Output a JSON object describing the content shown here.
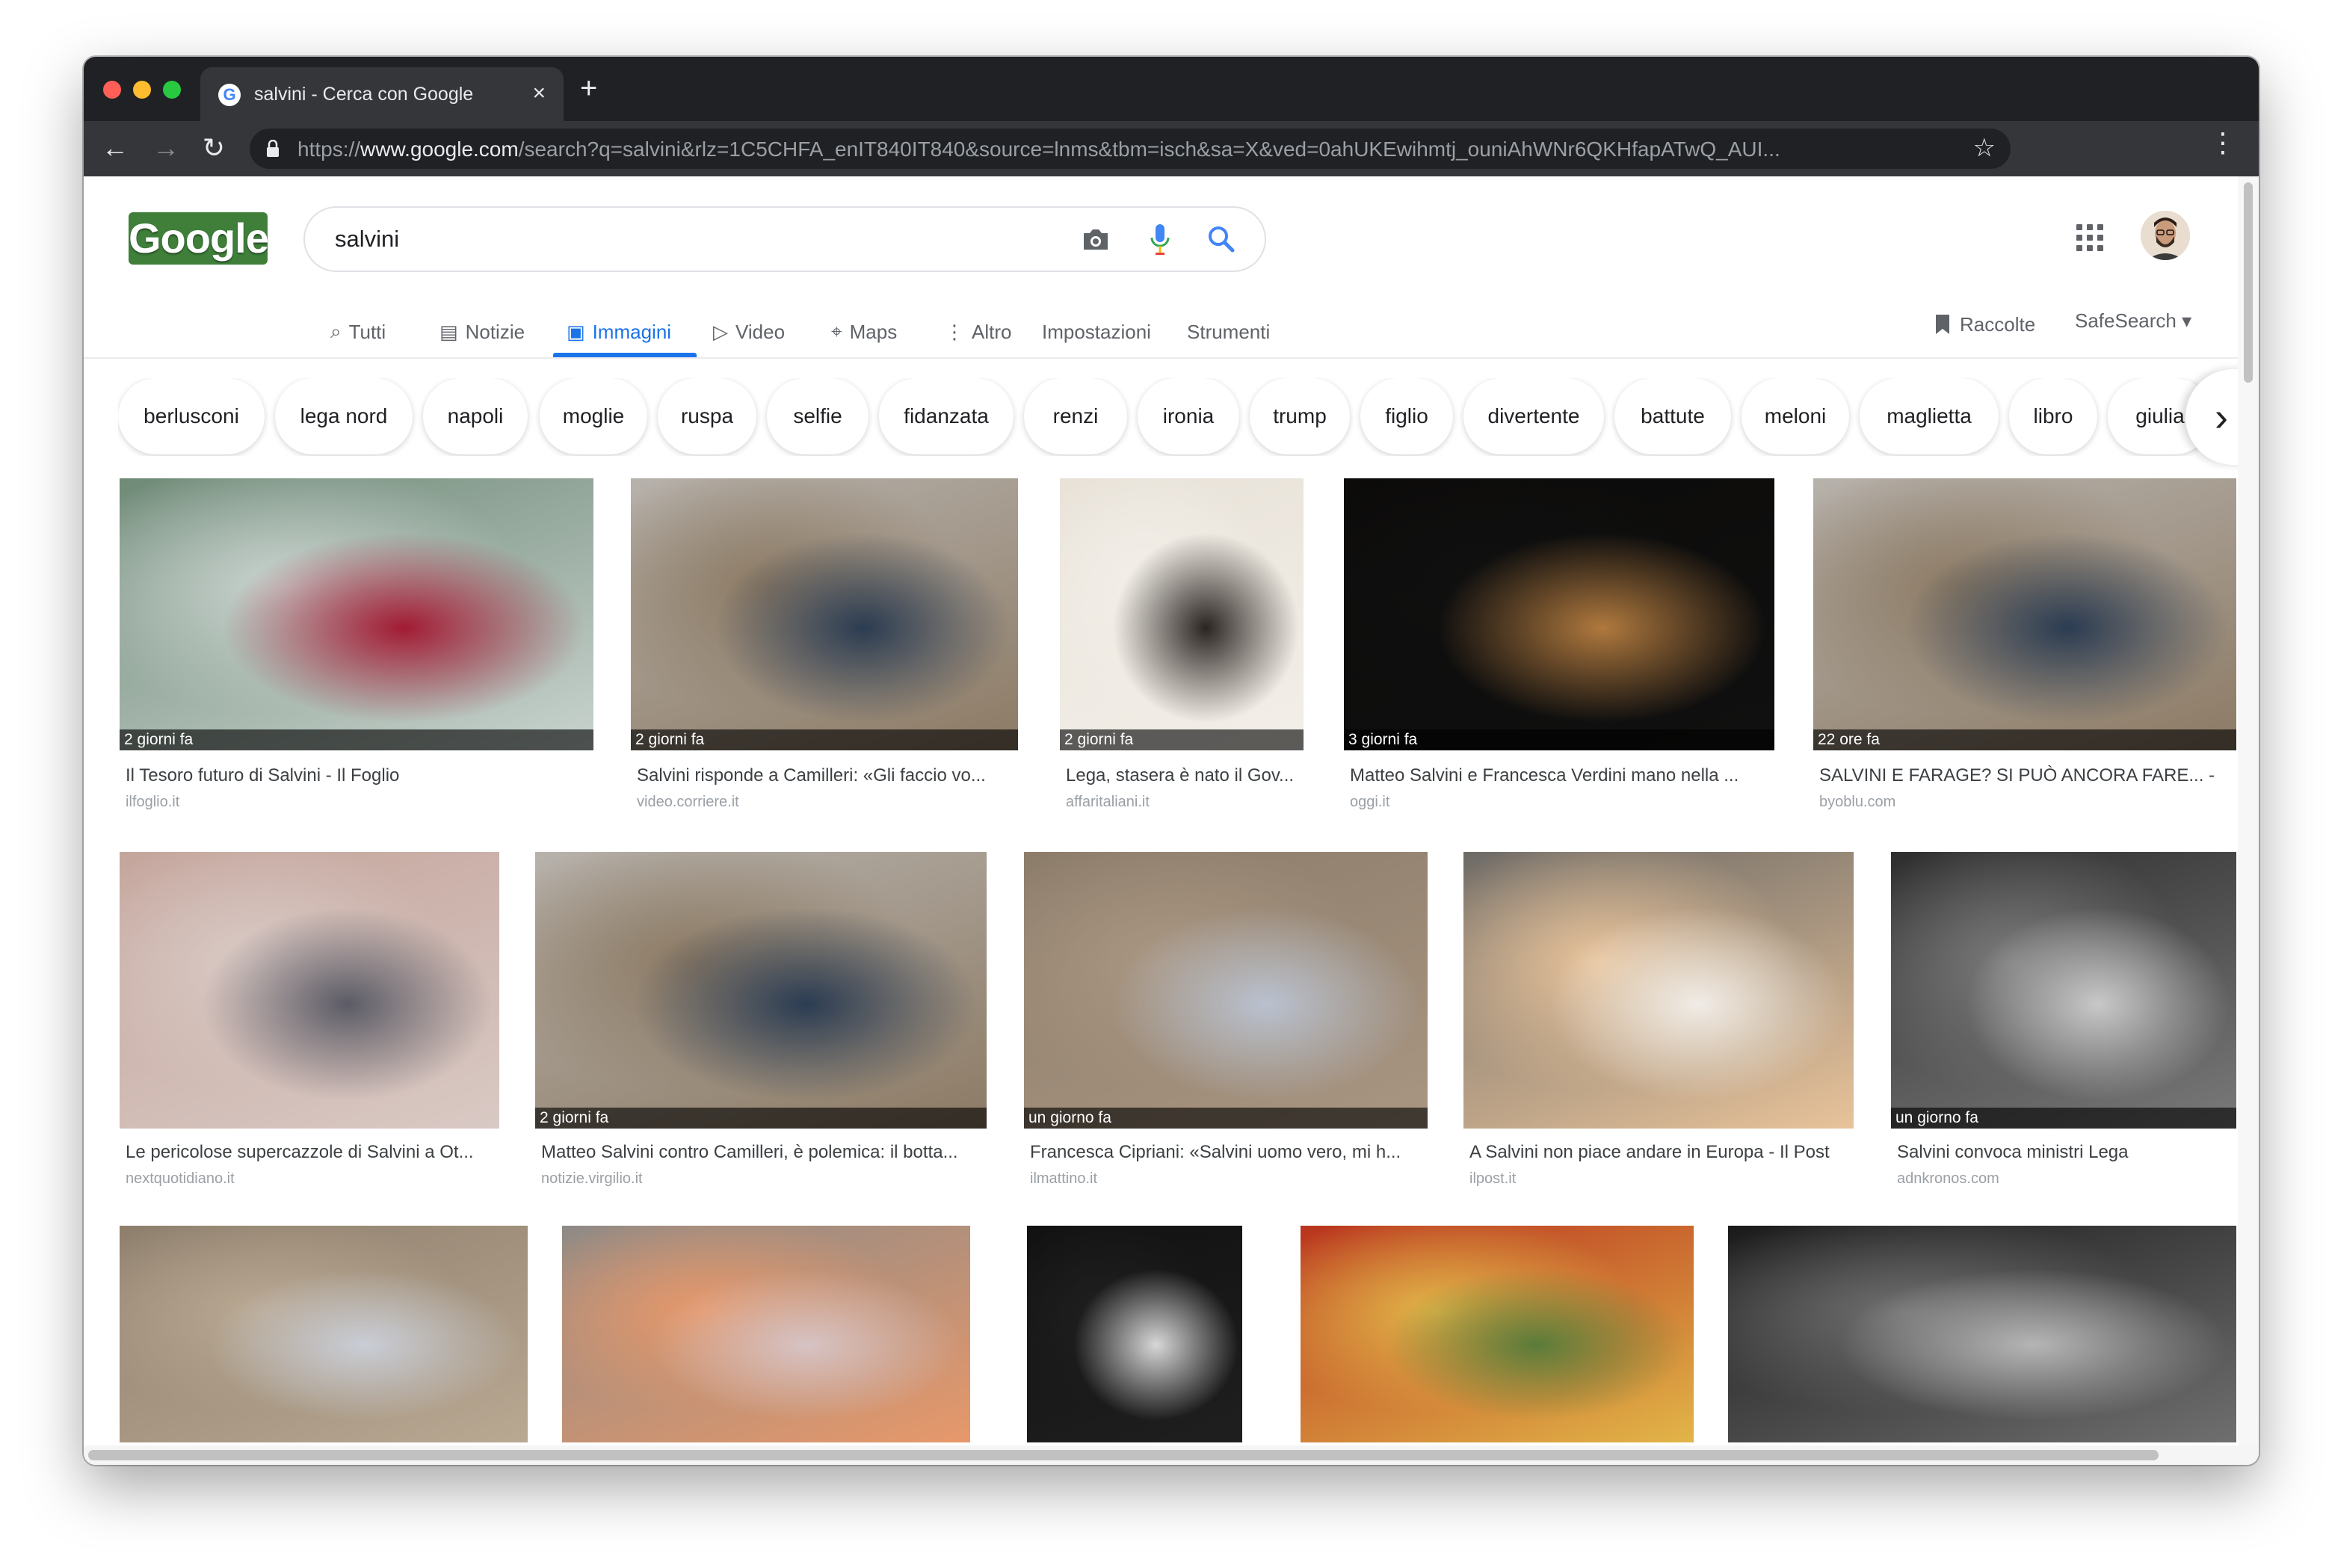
{
  "browser": {
    "tab_title": "salvini - Cerca con Google",
    "tab_close": "×",
    "new_tab": "+",
    "url_scheme": "https://",
    "url_host": "www.google.com",
    "url_path": "/search?q=salvini&rlz=1C5CHFA_enIT840IT840&source=lnms&tbm=isch&sa=X&ved=0ahUKEwihmtj_ouniAhWNr6QKHfapATwQ_AUI...",
    "back": "←",
    "forward": "→",
    "reload": "↻",
    "star": "☆",
    "menu": "⋮"
  },
  "header": {
    "logo_text": "Google",
    "search_value": "salvini"
  },
  "tabs": [
    {
      "label": "Tutti",
      "icon": "search-icon",
      "glyph": "⌕"
    },
    {
      "label": "Notizie",
      "icon": "news-icon",
      "glyph": "▤"
    },
    {
      "label": "Immagini",
      "icon": "images-icon",
      "glyph": "▣"
    },
    {
      "label": "Video",
      "icon": "video-icon",
      "glyph": "▷"
    },
    {
      "label": "Maps",
      "icon": "maps-icon",
      "glyph": "⌖"
    },
    {
      "label": "Altro",
      "icon": "more-icon",
      "glyph": "⋮"
    },
    {
      "label": "Impostazioni"
    },
    {
      "label": "Strumenti"
    }
  ],
  "right_links": {
    "collections": "Raccolte",
    "collections_glyph": "🔖",
    "safesearch": "SafeSearch ▾"
  },
  "chips": [
    "berlusconi",
    "lega nord",
    "napoli",
    "moglie",
    "ruspa",
    "selfie",
    "fidanzata",
    "renzi",
    "ironia",
    "trump",
    "figlio",
    "divertente",
    "battute",
    "meloni",
    "maglietta",
    "libro",
    "giulia"
  ],
  "chips_next": "›",
  "results_row1": [
    {
      "age": "2 giorni fa",
      "title": "Il Tesoro futuro di Salvini - Il Foglio",
      "source": "ilfoglio.it",
      "colors": [
        "#6f8a77",
        "#c9d3cf",
        "#a21b34"
      ]
    },
    {
      "age": "2 giorni fa",
      "title": "Salvini risponde a Camilleri: «Gli faccio vo...",
      "source": "video.corriere.it",
      "colors": [
        "#b7b2ac",
        "#8c7a64",
        "#2b3c52"
      ]
    },
    {
      "age": "2 giorni fa",
      "title": "Lega, stasera è nato il Gov...",
      "source": "affaritaliani.it",
      "colors": [
        "#e8e2d8",
        "#f3efe9",
        "#2a2521"
      ]
    },
    {
      "age": "3 giorni fa",
      "title": "Matteo Salvini e Francesca Verdini mano nella ...",
      "source": "oggi.it",
      "colors": [
        "#0c0b0a",
        "#101010",
        "#b0793e"
      ]
    },
    {
      "age": "22 ore fa",
      "title": "SALVINI E FARAGE? SI PUÒ ANCORA FARE... -",
      "source": "byoblu.com",
      "colors": [
        "#b7b2ac",
        "#8c7a64",
        "#2b3c52"
      ]
    }
  ],
  "results_row2": [
    {
      "age": "",
      "title": "Le pericolose supercazzole di Salvini a Ot...",
      "source": "nextquotidiano.it",
      "colors": [
        "#c4a59c",
        "#d9c9c4",
        "#5b5b66"
      ]
    },
    {
      "age": "2 giorni fa",
      "title": "Matteo Salvini contro Camilleri, è polemica: il botta...",
      "source": "notizie.virgilio.it",
      "colors": [
        "#b7b2ac",
        "#8c7a64",
        "#2b3c52"
      ]
    },
    {
      "age": "un giorno fa",
      "title": "Francesca Cipriani: «Salvini uomo vero, mi h...",
      "source": "ilmattino.it",
      "colors": [
        "#8c7c6a",
        "#a99682",
        "#b9c1cf"
      ]
    },
    {
      "age": "",
      "title": "A Salvini non piace andare in Europa - Il Post",
      "source": "ilpost.it",
      "colors": [
        "#6d6a66",
        "#e8c39a",
        "#f0ece6"
      ]
    },
    {
      "age": "un giorno fa",
      "title": "Salvini convoca ministri Lega",
      "source": "adnkronos.com",
      "colors": [
        "#2e2e2e",
        "#7a7a7a",
        "#c8c8c8"
      ]
    }
  ],
  "results_row3": [
    {
      "colors": [
        "#8e7f6d",
        "#b9a892",
        "#c9cdd6"
      ]
    },
    {
      "colors": [
        "#8f8a86",
        "#e7986a",
        "#d6c3c4"
      ]
    },
    {
      "colors": [
        "#111111",
        "#1f1f1f",
        "#d7d7d7"
      ]
    },
    {
      "colors": [
        "#b9341e",
        "#e2b548",
        "#5a7c3a"
      ]
    },
    {
      "colors": [
        "#1a1a1a",
        "#6f6f6f",
        "#b5b5b5"
      ]
    }
  ]
}
